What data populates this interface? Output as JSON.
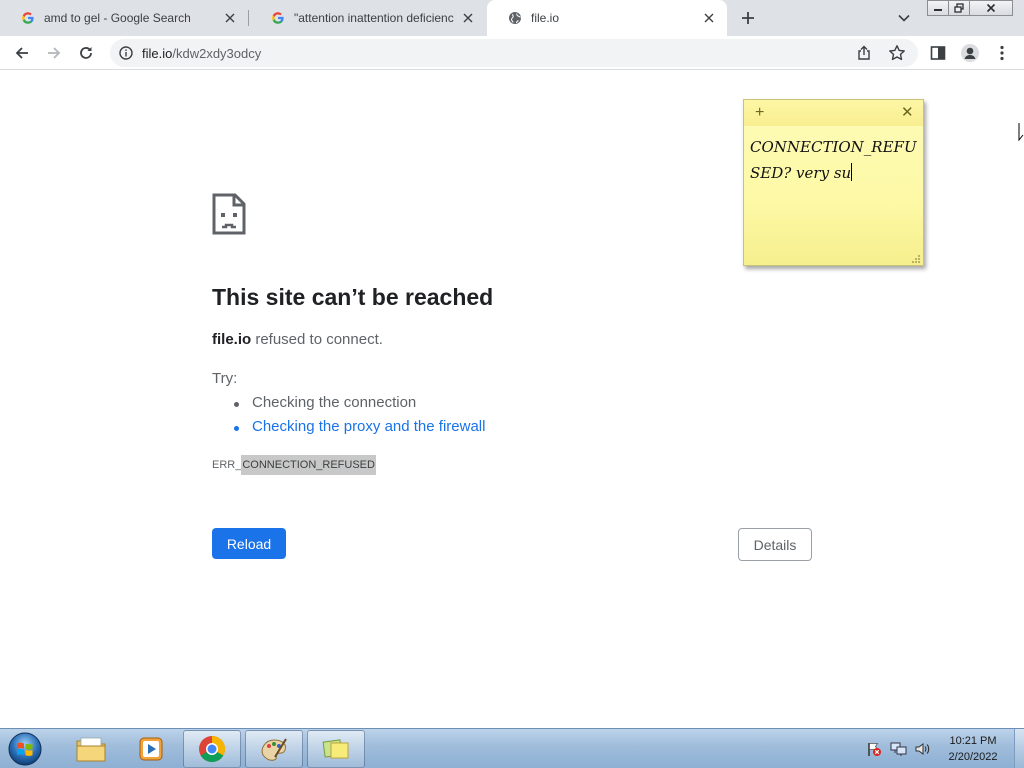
{
  "browser": {
    "tabs": [
      {
        "title": "amd to gel - Google Search",
        "favicon": "google-g-icon",
        "active": false
      },
      {
        "title": "\"attention inattention deficiency\"",
        "favicon": "google-g-icon",
        "active": false
      },
      {
        "title": "file.io",
        "favicon": "globe-icon",
        "active": true
      }
    ],
    "url": {
      "host": "file.io",
      "path": "/kdw2xdy3odcy"
    }
  },
  "error_page": {
    "title": "This site can’t be reached",
    "host": "file.io",
    "desc_suffix": " refused to connect.",
    "try_label": "Try:",
    "suggestions": [
      {
        "text": "Checking the connection",
        "link": false
      },
      {
        "text": "Checking the proxy and the firewall",
        "link": true
      }
    ],
    "error_code_prefix": "ERR_",
    "error_code_selected": "CONNECTION_REFUSED",
    "reload_label": "Reload",
    "details_label": "Details",
    "colors": {
      "primary_button": "#1a73e8",
      "link": "#1a73e8"
    }
  },
  "sticky_note": {
    "add_symbol": "+",
    "close_symbol": "✕",
    "text": "CONNECTION_REFUSED? very su"
  },
  "taskbar": {
    "pinned": [
      "start-orb-icon",
      "file-explorer-icon",
      "media-player-icon",
      "chrome-icon",
      "paint-icon",
      "sticky-notes-icon"
    ],
    "clock_time": "10:21 PM",
    "clock_date": "2/20/2022"
  }
}
